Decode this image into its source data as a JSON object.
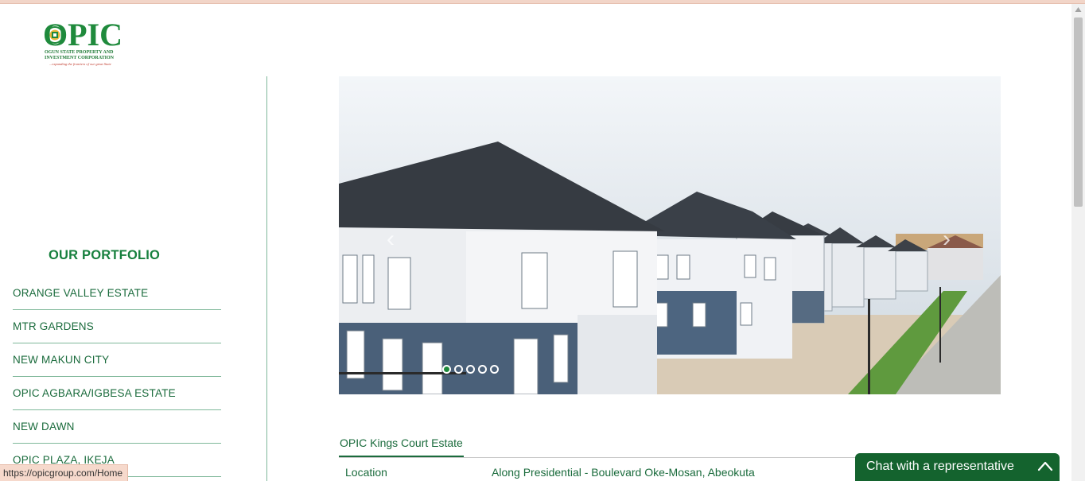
{
  "logo": {
    "mark_text": "OPIC",
    "subtitle": "OGUN STATE PROPERTY AND INVESTMENT CORPORATION",
    "tagline": "...expanding the frontiers of our great State"
  },
  "sidebar": {
    "title": "OUR PORTFOLIO",
    "items": [
      {
        "label": "ORANGE VALLEY ESTATE"
      },
      {
        "label": "MTR GARDENS"
      },
      {
        "label": "NEW MAKUN CITY"
      },
      {
        "label": "OPIC AGBARA/IGBESA ESTATE"
      },
      {
        "label": "NEW DAWN"
      },
      {
        "label": "OPIC PLAZA, IKEJA"
      }
    ]
  },
  "carousel": {
    "prev_glyph": "‹",
    "next_glyph": "›",
    "slide_count": 5,
    "active_index": 0
  },
  "estate": {
    "tab_label": "OPIC Kings Court Estate",
    "location_label": "Location",
    "location_value": "Along Presidential - Boulevard Oke-Mosan, Abeokuta"
  },
  "status_bar": {
    "url": "https://opicgroup.com/Home"
  },
  "chat": {
    "label": "Chat with a representative",
    "icon": "chevron-up-icon"
  },
  "colors": {
    "brand_green": "#1a6b3c",
    "chat_green": "#14632e"
  }
}
